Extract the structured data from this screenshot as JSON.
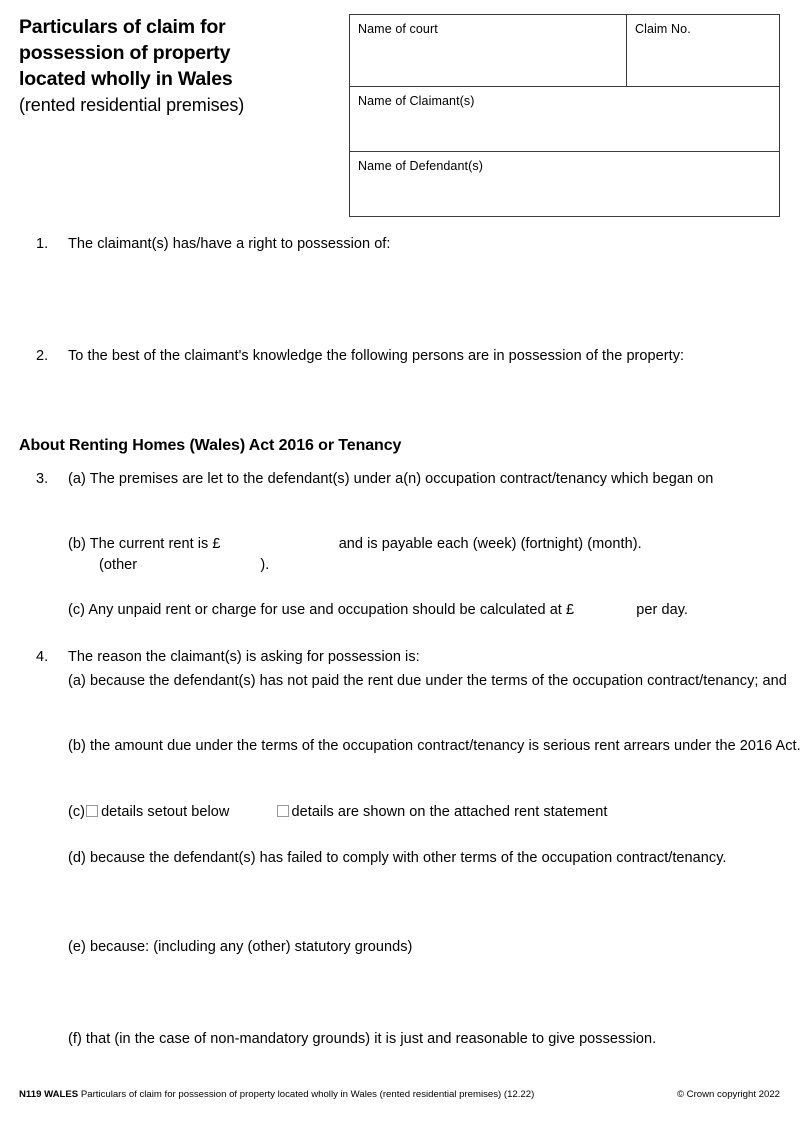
{
  "header": {
    "title_lines": [
      "Particulars of claim for",
      "possession of property",
      "located wholly in Wales"
    ],
    "subtitle": "(rented residential premises)"
  },
  "court_details": {
    "name_of_court_label": "Name of court",
    "claim_no_label": "Claim No.",
    "name_of_claimants_label": "Name of Claimant(s)",
    "name_of_defendants_label": "Name of Defendant(s)"
  },
  "items": {
    "item1": {
      "number": "1.",
      "text": "The claimant(s) has/have a right to possession of:"
    },
    "item2": {
      "number": "2.",
      "text": "To the best of the claimant's knowledge the following persons are in possession of the property:"
    },
    "section_heading": "About Renting Homes (Wales) Act 2016 or Tenancy",
    "item3": {
      "number": "3.",
      "a": "(a) The premises are let to the defendant(s) under a(n) occupation contract/tenancy which began on",
      "b_part1": "(b) The current rent is £",
      "b_part2": "and is payable each (week) (fortnight) (month).",
      "b_part3": "(other",
      "b_part4": ").",
      "c_part1": "(c) Any unpaid rent or charge for use and occupation should be calculated at £",
      "c_part2": "per day."
    },
    "item4": {
      "number": "4.",
      "text": "The reason the claimant(s) is asking for possession is:",
      "a": "(a) because the defendant(s) has not paid the rent due under the terms of the occupation contract/tenancy; and",
      "b": "(b) the amount due under the terms of the occupation contract/tenancy is serious rent arrears under the 2016 Act.",
      "c_prefix": "(c)",
      "c_option1": "details setout below",
      "c_option2": "details are shown on the attached rent statement",
      "d": "(d) because the defendant(s) has failed to comply with other terms of the occupation contract/tenancy.",
      "e": "(e) because: (including any (other) statutory grounds)",
      "f": "(f) that (in the case of non-mandatory grounds) it is just and reasonable to give possession."
    }
  },
  "footer": {
    "form_code": "N119 WALES",
    "description": "Particulars of claim for possession of property located wholly in Wales (rented residential premises) (12.22)",
    "copyright": "© Crown copyright 2022"
  }
}
